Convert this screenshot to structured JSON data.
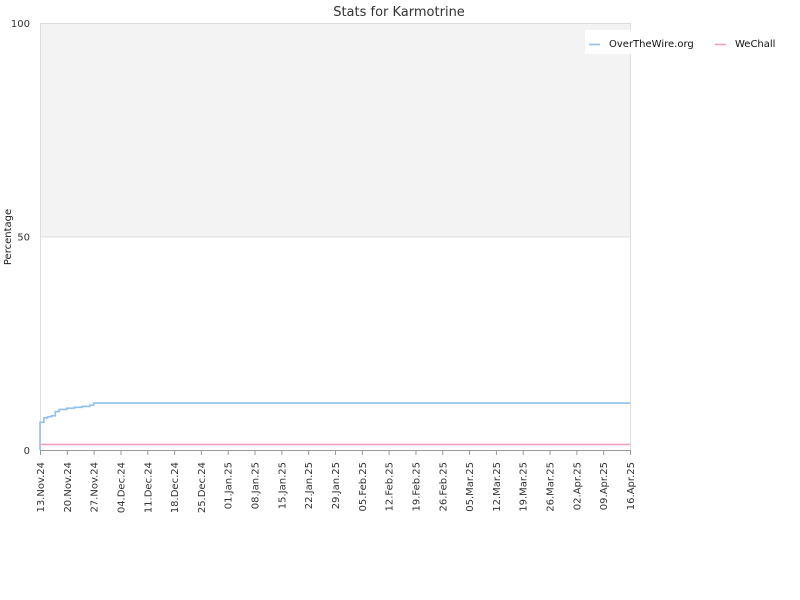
{
  "chart_data": {
    "type": "line",
    "title": "Stats for Karmotrine",
    "xlabel": "",
    "ylabel": "Percentage",
    "ylim": [
      0,
      100
    ],
    "yticks": [
      0,
      50,
      100
    ],
    "xlim": [
      "2024-11-13",
      "2025-04-16"
    ],
    "xticks": [
      "13.Nov.24",
      "20.Nov.24",
      "27.Nov.24",
      "04.Dec.24",
      "11.Dec.24",
      "18.Dec.24",
      "25.Dec.24",
      "01.Jan.25",
      "08.Jan.25",
      "15.Jan.25",
      "22.Jan.25",
      "29.Jan.25",
      "05.Feb.25",
      "12.Feb.25",
      "19.Feb.25",
      "26.Feb.25",
      "05.Mar.25",
      "12.Mar.25",
      "19.Mar.25",
      "26.Mar.25",
      "02.Apr.25",
      "09.Apr.25",
      "16.Apr.25"
    ],
    "legend_position": "top-right",
    "series": [
      {
        "name": "OverTheWire.org",
        "color": "#90c0f0",
        "step": true,
        "points": [
          [
            "2024-11-13",
            0
          ],
          [
            "2024-11-13",
            5
          ],
          [
            "2024-11-13",
            6.5
          ],
          [
            "2024-11-14",
            7.5
          ],
          [
            "2024-11-15",
            7.8
          ],
          [
            "2024-11-16",
            8
          ],
          [
            "2024-11-17",
            9
          ],
          [
            "2024-11-18",
            9.5
          ],
          [
            "2024-11-20",
            9.8
          ],
          [
            "2024-11-22",
            10
          ],
          [
            "2024-11-24",
            10.2
          ],
          [
            "2024-11-26",
            10.5
          ],
          [
            "2024-11-27",
            11
          ],
          [
            "2025-04-16",
            11
          ]
        ]
      },
      {
        "name": "WeChall",
        "color": "#f0a0c0",
        "step": true,
        "points": [
          [
            "2024-11-13",
            1.3
          ],
          [
            "2025-04-16",
            1.3
          ]
        ]
      }
    ]
  }
}
